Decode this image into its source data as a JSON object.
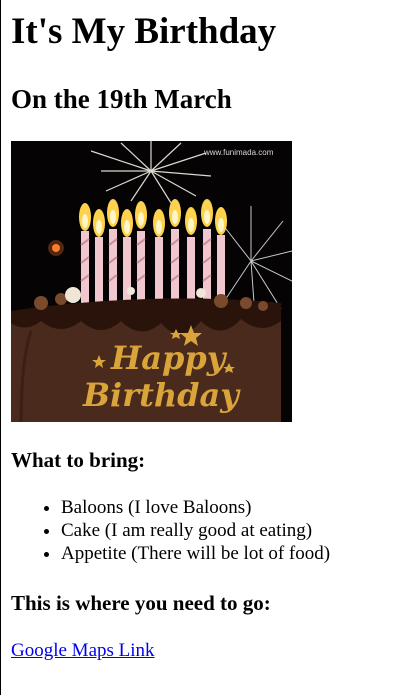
{
  "page": {
    "title": "It's My Birthday",
    "subtitle": "On the 19th March"
  },
  "hero_image": {
    "watermark": "www.funimada.com",
    "caption_line1": "Happy",
    "caption_line2": "Birthday",
    "colors": {
      "background": "#050303",
      "cake": "#4a2a1c",
      "frosting": "#2a130b",
      "gold": "#d9a53a",
      "flame": "#ffd24d"
    }
  },
  "bring_section": {
    "heading": "What to bring:",
    "items": [
      "Baloons (I love Baloons)",
      "Cake (I am really good at eating)",
      "Appetite (There will be lot of food)"
    ]
  },
  "location_section": {
    "heading": "This is where you need to go:",
    "link_label": "Google Maps Link",
    "link_color": "#0000ee"
  }
}
